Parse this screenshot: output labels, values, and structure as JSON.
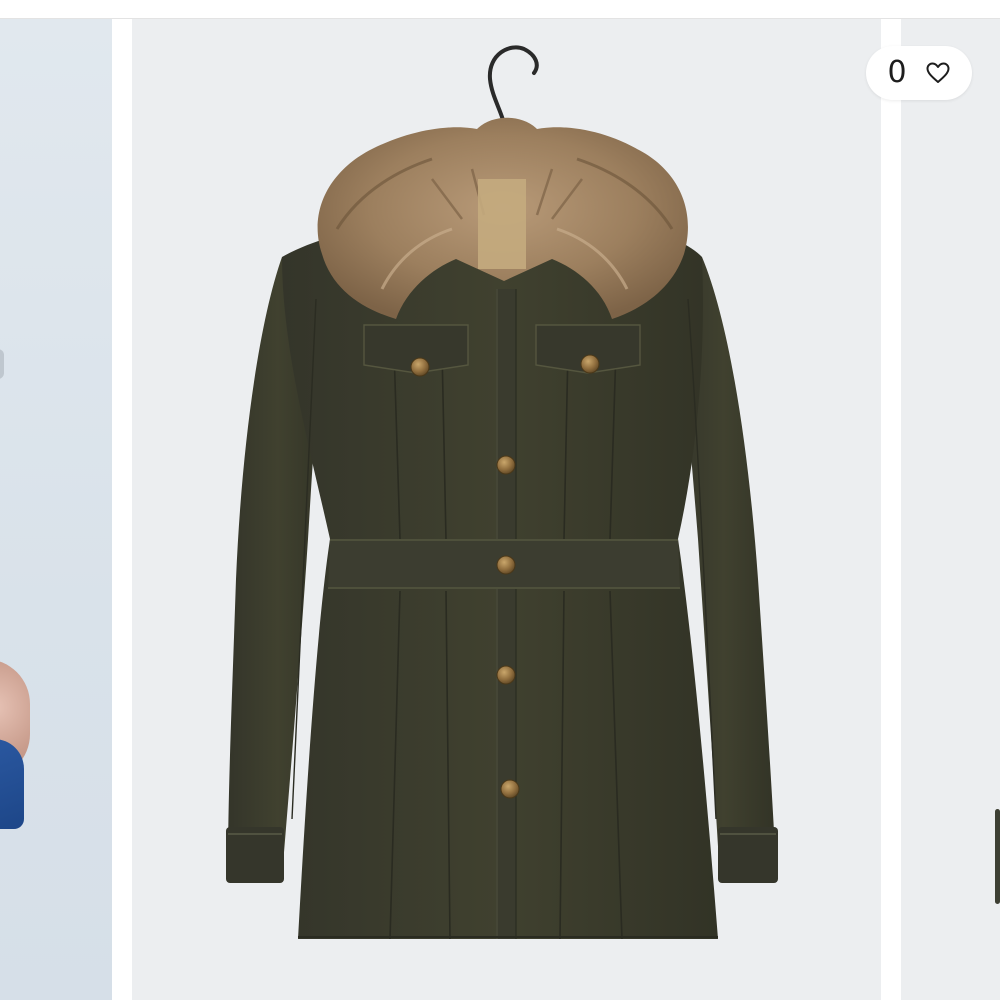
{
  "favorite": {
    "count": "0",
    "icon": "heart-outline-icon"
  },
  "carousel": {
    "slides": [
      {
        "role": "previous",
        "description": "model-photo"
      },
      {
        "role": "current",
        "description": "product-photo"
      },
      {
        "role": "next",
        "description": "product-photo"
      }
    ]
  },
  "colors": {
    "slide_background": "#eceef0",
    "coat": "#3c3d30",
    "fur": "#a48766",
    "buttons": "#8a6a3c"
  }
}
